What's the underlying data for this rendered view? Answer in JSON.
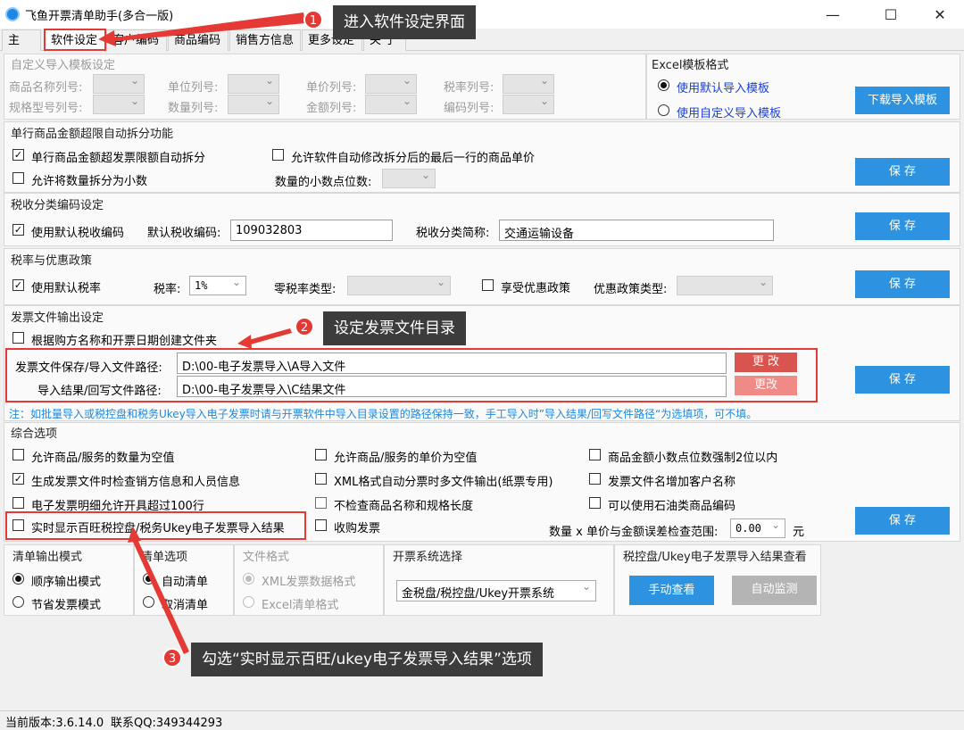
{
  "window": {
    "title": "飞鱼开票清单助手(多合一版)",
    "minimize": "—",
    "maximize": "☐",
    "close": "✕"
  },
  "tabs": [
    "主 页",
    "软件设定",
    "客户编码",
    "商品编码",
    "销售方信息",
    "更多设定",
    "关 于"
  ],
  "template": {
    "title": "自定义导入模板设定",
    "fields": [
      "商品名称列号:",
      "单位列号:",
      "单价列号:",
      "税率列号:",
      "规格型号列号:",
      "数量列号:",
      "金额列号:",
      "编码列号:"
    ]
  },
  "excel": {
    "title": "Excel模板格式",
    "default_label": "使用默认导入模板",
    "custom_label": "使用自定义导入模板",
    "download_button": "下载导入模板"
  },
  "split": {
    "title": "单行商品金额超限自动拆分功能",
    "auto_split": "单行商品金额超发票限额自动拆分",
    "allow_modify": "允许软件自动修改拆分后的最后一行的商品单价",
    "allow_decimal": "允许将数量拆分为小数",
    "decimal_places_label": "数量的小数点位数:",
    "save": "保 存"
  },
  "tax_code": {
    "title": "税收分类编码设定",
    "use_default": "使用默认税收编码",
    "default_code_label": "默认税收编码:",
    "default_code_value": "109032803",
    "short_name_label": "税收分类简称:",
    "short_name_value": "交通运输设备",
    "save": "保 存"
  },
  "tax_rate": {
    "title": "税率与优惠政策",
    "use_default": "使用默认税率",
    "rate_label": "税率:",
    "rate_value": "1%",
    "zero_type_label": "零税率类型:",
    "preferential": "享受优惠政策",
    "policy_type_label": "优惠政策类型:",
    "save": "保 存"
  },
  "output": {
    "title": "发票文件输出设定",
    "create_folder": "根据购方名称和开票日期创建文件夹",
    "save_path_label": "发票文件保存/导入文件路径:",
    "save_path_value": "D:\\00-电子发票导入\\A导入文件",
    "result_path_label": "导入结果/回写文件路径:",
    "result_path_value": "D:\\00-电子发票导入\\C结果文件",
    "change": "更 改",
    "change2": "更改",
    "save": "保 存",
    "note": "注：如批量导入或税控盘和税务Ukey导入电子发票时请与开票软件中导入目录设置的路径保持一致，手工导入时”导入结果/回写文件路径“为选填项，可不填。"
  },
  "options": {
    "title": "综合选项",
    "items": [
      "允许商品/服务的数量为空值",
      "允许商品/服务的单价为空值",
      "商品金额小数点位数强制2位以内",
      "生成发票文件时检查销方信息和人员信息",
      "XML格式自动分票时多文件输出(纸票专用)",
      "发票文件名增加客户名称",
      "电子发票明细允许开具超过100行",
      "不检查商品名称和规格长度",
      "可以使用石油类商品编码",
      "实时显示百旺税控盘/税务Ukey电子发票导入结果",
      "收购发票"
    ],
    "tolerance_label": "数量 x 单价与金额误差检查范围:",
    "tolerance_value": "0.00",
    "tolerance_unit": "元",
    "save": "保 存"
  },
  "list_mode": {
    "title": "清单输出模式",
    "sequential": "顺序输出模式",
    "save_invoice": "节省发票模式"
  },
  "list_options": {
    "title": "清单选项",
    "auto": "自动清单",
    "cancel": "取消清单"
  },
  "file_format": {
    "title": "文件格式",
    "xml": "XML发票数据格式",
    "excel": "Excel清单格式"
  },
  "system": {
    "title": "开票系统选择",
    "value": "金税盘/税控盘/Ukey开票系统"
  },
  "result_view": {
    "title": "税控盘/Ukey电子发票导入结果查看",
    "manual": "手动查看",
    "auto": "自动监测"
  },
  "callouts": {
    "step1": {
      "num": "1",
      "text": "进入软件设定界面"
    },
    "step2": {
      "num": "2",
      "text": "设定发票文件目录"
    },
    "step3": {
      "num": "3",
      "text": "勾选“实时显示百旺/ukey电子发票导入结果”选项"
    }
  },
  "status": {
    "version": "当前版本:3.6.14.0",
    "qq": "联系QQ:349344293"
  },
  "colors": {
    "accent": "#2d93e0",
    "highlight": "#e53935",
    "callout_bg": "#3c3c3c"
  }
}
